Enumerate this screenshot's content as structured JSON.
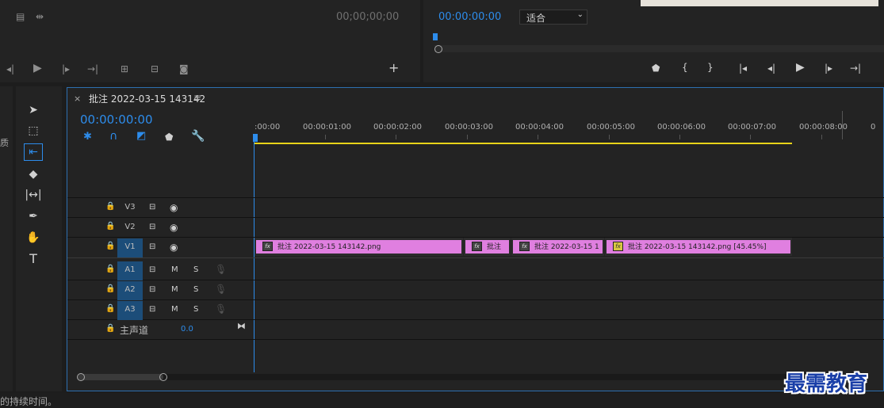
{
  "source_monitor": {
    "timecode": "00;00;00;00"
  },
  "program_monitor": {
    "timecode": "00:00:00:00",
    "fit_label": "适合"
  },
  "sequence": {
    "tab_title": "批注 2022-03-15 143142",
    "timecode": "00:00:00:00"
  },
  "ruler": {
    "labels": [
      ":00:00",
      "00:00:01:00",
      "00:00:02:00",
      "00:00:03:00",
      "00:00:04:00",
      "00:00:05:00",
      "00:00:06:00",
      "00:00:07:00",
      "00:00:08:00"
    ]
  },
  "tracks": {
    "video": [
      "V3",
      "V2",
      "V1"
    ],
    "audio": [
      "A1",
      "A2",
      "A3"
    ],
    "mute": "M",
    "solo": "S",
    "master_label": "主声道",
    "master_value": "0.0"
  },
  "clips": [
    {
      "label": "批注 2022-03-15  143142.png",
      "fx": "fx",
      "fx_active": false
    },
    {
      "label": "批注",
      "fx": "fx",
      "fx_active": false
    },
    {
      "label": "批注 2022-03-15 1",
      "fx": "fx",
      "fx_active": false
    },
    {
      "label": "批注 2022-03-15  143142.png [45.45%]",
      "fx": "fx",
      "fx_active": true
    }
  ],
  "status_bar": {
    "text": "的持续时间。"
  },
  "watermark": {
    "text": "最需教育"
  },
  "left_edge_fragment": "质",
  "colors": {
    "accent": "#2d8ceb",
    "clip": "#e07fe0",
    "work_area": "#e8d319"
  }
}
